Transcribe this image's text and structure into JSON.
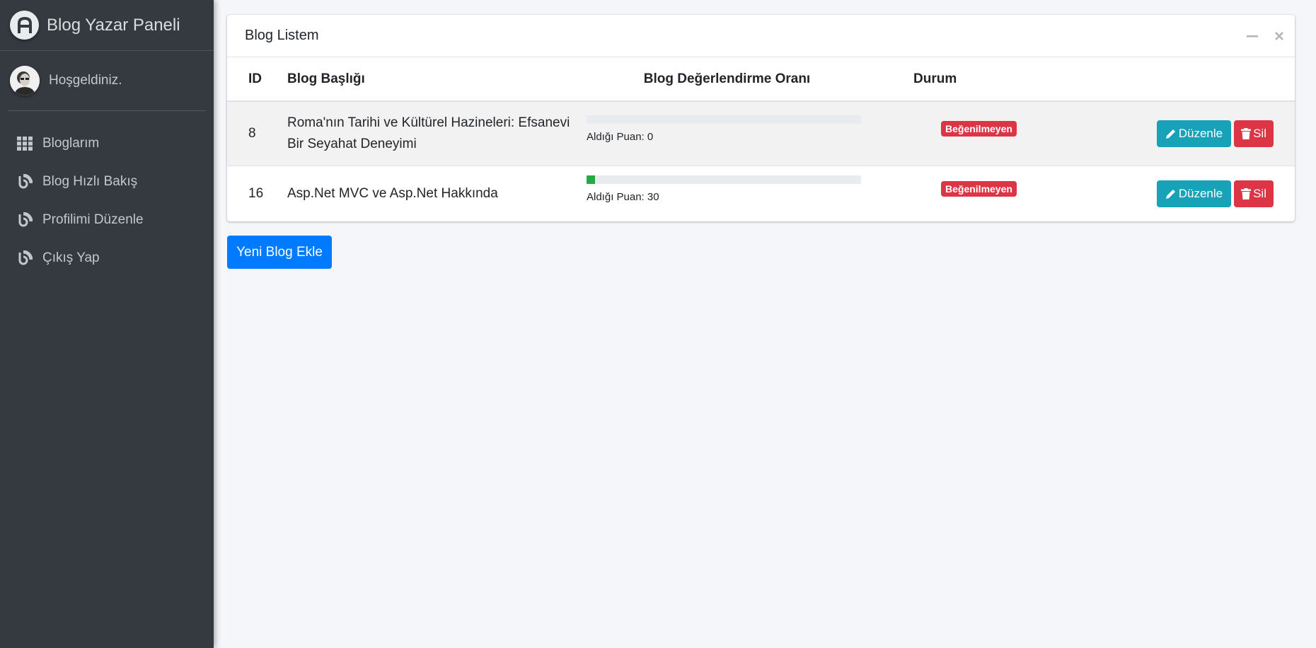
{
  "sidebar": {
    "brand": "Blog Yazar Paneli",
    "user_greeting": "Hoşgeldiniz.",
    "items": [
      {
        "label": "Bloglarım",
        "icon": "grid-icon"
      },
      {
        "label": "Blog Hızlı Bakış",
        "icon": "rss-icon"
      },
      {
        "label": "Profilimi Düzenle",
        "icon": "rss-icon"
      },
      {
        "label": "Çıkış Yap",
        "icon": "rss-icon"
      }
    ]
  },
  "card": {
    "title": "Blog Listem",
    "columns": [
      "ID",
      "Blog Başlığı",
      "Blog Değerlendirme Oranı",
      "Durum",
      ""
    ],
    "rows": [
      {
        "id": "8",
        "title": "Roma'nın Tarihi ve Kültürel Hazineleri: Efsanevi Bir Seyahat Deneyimi",
        "score_text": "Aldığı Puan: 0",
        "score_fraction": 0,
        "status": "Beğenilmeyen",
        "edit_label": "Düzenle",
        "delete_label": "Sil"
      },
      {
        "id": "16",
        "title": "Asp.Net MVC ve Asp.Net Hakkında",
        "score_text": "Aldığı Puan: 30",
        "score_fraction": 0.03,
        "status": "Beğenilmeyen",
        "edit_label": "Düzenle",
        "delete_label": "Sil"
      }
    ]
  },
  "new_blog_button": "Yeni Blog Ekle",
  "colors": {
    "sidebar": "#343a40",
    "primary": "#007bff",
    "info": "#17a2b8",
    "danger": "#dc3545",
    "success": "#28a745"
  }
}
